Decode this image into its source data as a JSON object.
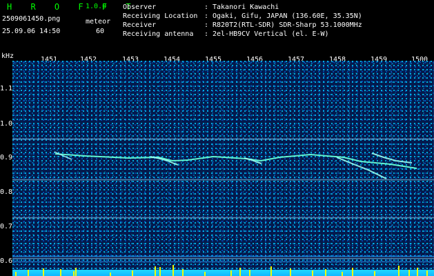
{
  "header": {
    "logo": "H R O F F T",
    "version": "1.0.0",
    "filename": "2509061450.png",
    "timestamp": "25.09.06 14:50",
    "mode": "meteor",
    "count": "60"
  },
  "info": {
    "rows": [
      {
        "label": "Observer",
        "value": "Takanori Kawachi"
      },
      {
        "label": "Receiving Location",
        "value": "Ogaki, Gifu, JAPAN (136.60E, 35.35N)"
      },
      {
        "label": "Receiver",
        "value": "R820T2(RTL-SDR) SDR-Sharp 53.1000MHz"
      },
      {
        "label": "Receiving antenna",
        "value": "2el-HB9CV Vertical (el. E-W)"
      }
    ]
  },
  "plot": {
    "unit": "kHz",
    "x_ticks": [
      "1451",
      "1452",
      "1453",
      "1454",
      "1455",
      "1456",
      "1457",
      "1458",
      "1459",
      "1500"
    ],
    "y_ticks": [
      "1.1",
      "1.0",
      "0.9",
      "0.8",
      "0.7",
      "0.6"
    ],
    "colors": {
      "background": "#041a4d",
      "noise_primary": "#00d2ff",
      "noise_secondary": "#006eff",
      "echo": "#66ffd5",
      "baseline": "#1ed8ff",
      "spikes": "#f3ff00"
    }
  }
}
